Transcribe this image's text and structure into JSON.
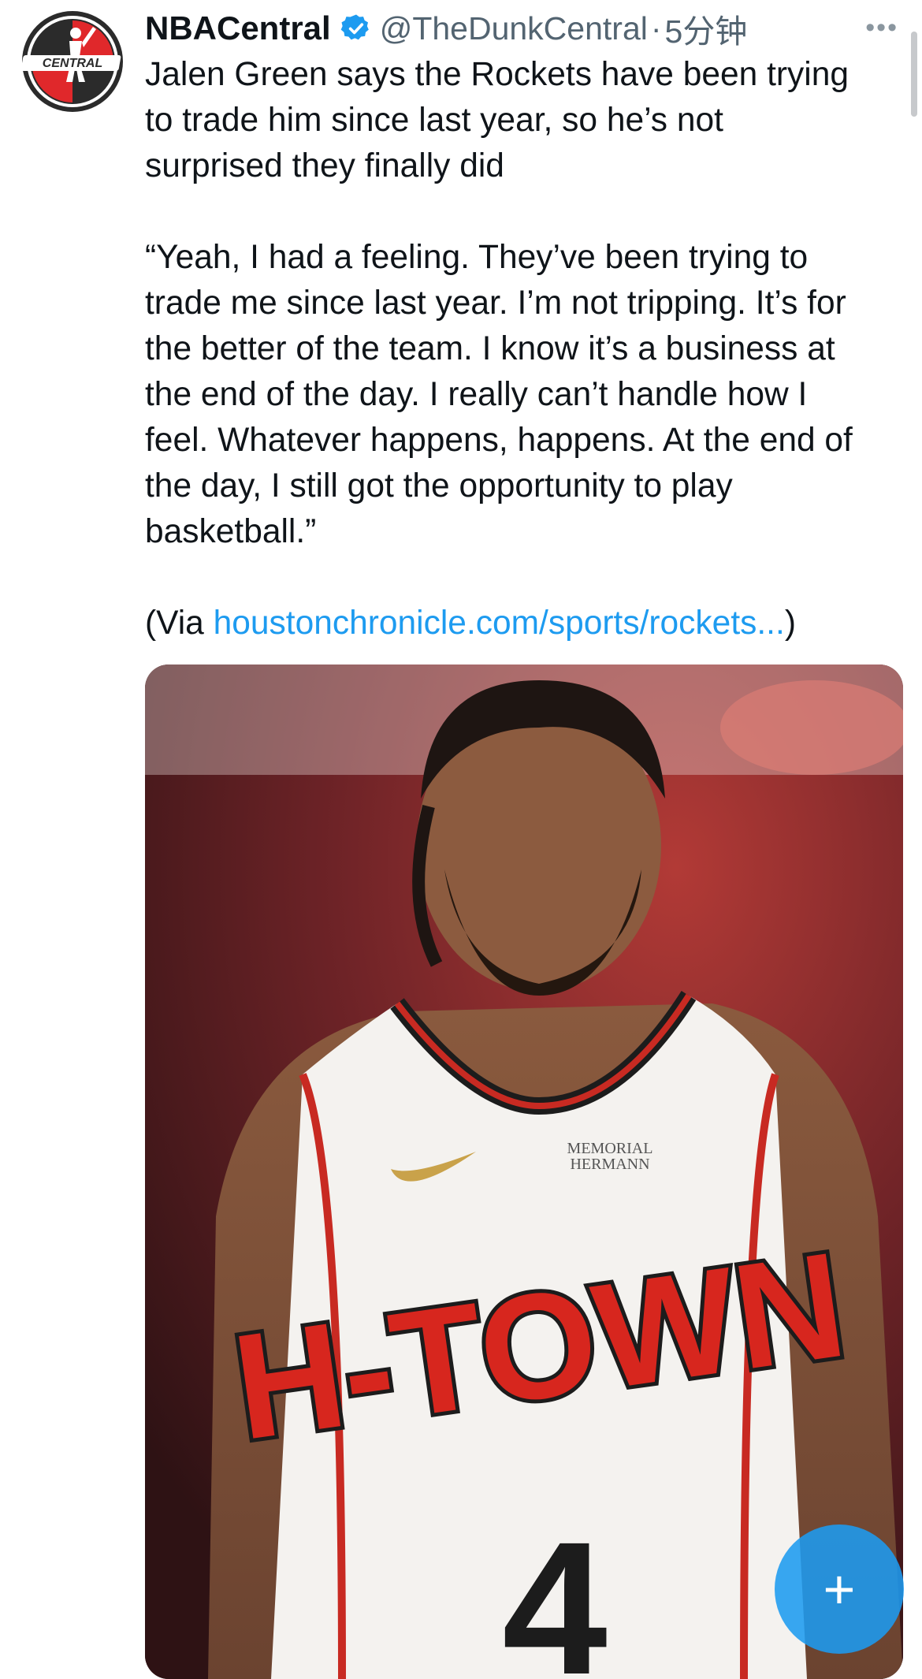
{
  "tweet": {
    "display_name": "NBACentral",
    "handle": "@TheDunkCentral",
    "separator": "·",
    "time": "5分钟",
    "more_icon": "more-horizontal-icon",
    "avatar_text": "CENTRAL",
    "text_line_1": "Jalen Green says the Rockets have been trying\nto trade him since last year, so he’s not\nsurprised they finally did",
    "text_quote": "“Yeah, I had a feeling. They’ve been trying to\ntrade me since last year. I’m not tripping. It’s for\nthe better of the team. I know it’s a business at\nthe end of the day. I really can’t handle how I\nfeel. Whatever happens, happens. At the end of\nthe day, I still got the opportunity to play\nbasketball.”",
    "via_prefix": "(Via ",
    "via_link": "houstonchronicle.com/sports/rockets...",
    "via_suffix": ")"
  },
  "media": {
    "jersey_text": "H-TOWN",
    "jersey_number": "4",
    "sponsor_line_1": "MEMORIAL",
    "sponsor_line_2": "HERMANN"
  },
  "compose_button": {
    "icon": "plus-icon"
  },
  "colors": {
    "link": "#1d9bf0",
    "secondary_text": "#536471",
    "verified": "#1d9bf0",
    "jersey_red": "#d7261e"
  }
}
